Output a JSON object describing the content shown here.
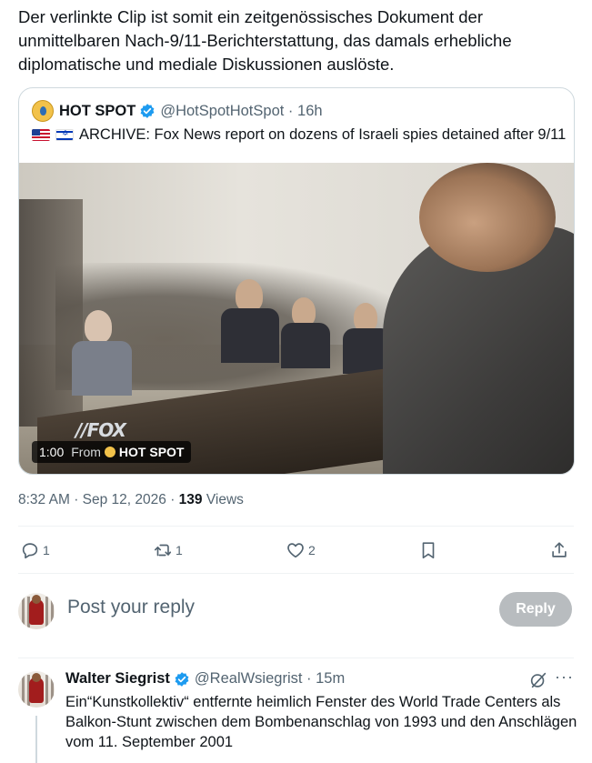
{
  "post": {
    "text": "Der verlinkte Clip ist somit ein zeitgenössisches Dokument der unmittelbaren Nach-9/11-Berichterstattung, das damals erhebliche diplomatische und mediale Diskussionen auslöste."
  },
  "quote": {
    "name": "HOT SPOT",
    "handle": "@HotSpotHotSpot",
    "time": "16h",
    "text": "ARCHIVE: Fox News report on dozens of Israeli spies detained after 9/11",
    "flags": [
      "us-flag",
      "israel-flag"
    ],
    "video": {
      "duration": "1:00",
      "from_label": "From",
      "source": "HOT SPOT",
      "logo_text": "//FOX"
    }
  },
  "meta": {
    "time": "8:32 AM",
    "date": "Sep 12, 2026",
    "views_count": "139",
    "views_label": "Views"
  },
  "actions": {
    "replies": "1",
    "reposts": "1",
    "likes": "2"
  },
  "reply_box": {
    "placeholder": "Post your reply",
    "button_label": "Reply"
  },
  "reply": {
    "name": "Walter Siegrist",
    "handle": "@RealWsiegrist",
    "time": "15m",
    "text": "Ein“Kunstkollektiv“ entfernte heimlich Fenster des World Trade Centers als Balkon-Stunt zwischen dem Bombenanschlag von 1993 und den Anschlägen vom 11. September 2001"
  },
  "colors": {
    "text": "#0f1419",
    "secondary": "#536471",
    "verified": "#1d9bf0",
    "border": "#cfd9de",
    "reply_button_disabled": "#b8bcbf"
  }
}
